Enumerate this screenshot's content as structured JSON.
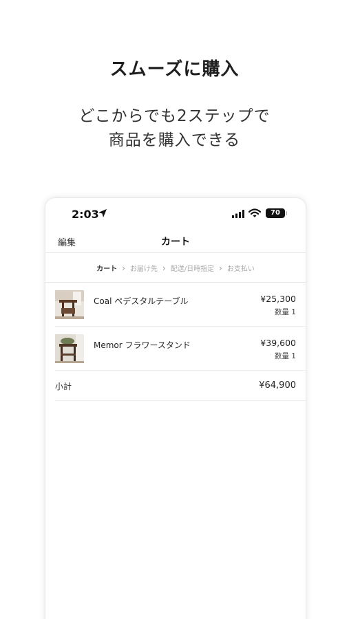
{
  "promo": {
    "headline": "スムーズに購入",
    "subline_1": "どこからでも2ステップで",
    "subline_2": "商品を購入できる"
  },
  "status_bar": {
    "time": "2:03",
    "battery": "70"
  },
  "nav": {
    "edit_label": "編集",
    "title": "カート"
  },
  "steps": [
    "カート",
    "お届け先",
    "配送/日時指定",
    "お支払い"
  ],
  "cart": {
    "items": [
      {
        "name": "Coal ペデスタルテーブル",
        "price": "¥25,300",
        "quantity": "数量 1"
      },
      {
        "name": "Memor フラワースタンド",
        "price": "¥39,600",
        "quantity": "数量 1"
      }
    ],
    "subtotal_label": "小計",
    "subtotal_value": "¥64,900"
  }
}
